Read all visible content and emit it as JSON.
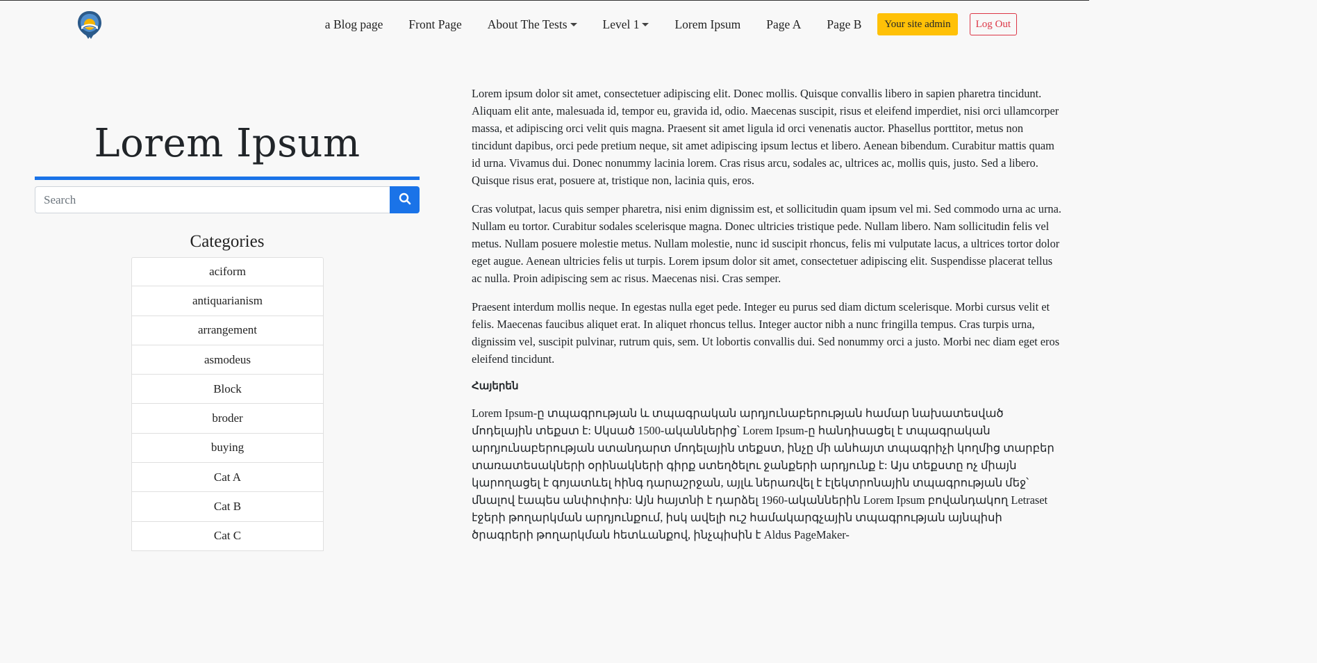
{
  "colors": {
    "accent": "#1a73e8",
    "admin_button": "#ffc107",
    "logout_button": "#dc3545"
  },
  "nav": {
    "logo": "site-logo-icon",
    "items": [
      {
        "label": "a Blog page",
        "dropdown": false
      },
      {
        "label": "Front Page",
        "dropdown": false
      },
      {
        "label": "About The Tests",
        "dropdown": true
      },
      {
        "label": "Level 1",
        "dropdown": true
      },
      {
        "label": "Lorem Ipsum",
        "dropdown": false
      },
      {
        "label": "Page A",
        "dropdown": false
      },
      {
        "label": "Page B",
        "dropdown": false
      }
    ],
    "admin_label": "Your site admin",
    "logout_label": "Log Out"
  },
  "sidebar": {
    "title": "Lorem Ipsum",
    "search": {
      "placeholder": "Search",
      "value": "",
      "icon": "search-icon"
    },
    "categories_title": "Categories",
    "categories": [
      "aciform",
      "antiquarianism",
      "arrangement",
      "asmodeus",
      "Block",
      "broder",
      "buying",
      "Cat A",
      "Cat B",
      "Cat C"
    ]
  },
  "content": {
    "paragraph_1": "Lorem ipsum dolor sit amet, consectetuer adipiscing elit. Donec mollis. Quisque convallis libero in sapien pharetra tincidunt. Aliquam elit ante, malesuada id, tempor eu, gravida id, odio. Maecenas suscipit, risus et eleifend imperdiet, nisi orci ullamcorper massa, et adipiscing orci velit quis magna. Praesent sit amet ligula id orci venenatis auctor. Phasellus porttitor, metus non tincidunt dapibus, orci pede pretium neque, sit amet adipiscing ipsum lectus et libero. Aenean bibendum. Curabitur mattis quam id urna. Vivamus dui. Donec nonummy lacinia lorem. Cras risus arcu, sodales ac, ultrices ac, mollis quis, justo. Sed a libero. Quisque risus erat, posuere at, tristique non, lacinia quis, eros.",
    "paragraph_2": "Cras volutpat, lacus quis semper pharetra, nisi enim dignissim est, et sollicitudin quam ipsum vel mi. Sed commodo urna ac urna. Nullam eu tortor. Curabitur sodales scelerisque magna. Donec ultricies tristique pede. Nullam libero. Nam sollicitudin felis vel metus. Nullam posuere molestie metus. Nullam molestie, nunc id suscipit rhoncus, felis mi vulputate lacus, a ultrices tortor dolor eget augue. Aenean ultricies felis ut turpis. Lorem ipsum dolor sit amet, consectetuer adipiscing elit. Suspendisse placerat tellus ac nulla. Proin adipiscing sem ac risus. Maecenas nisi. Cras semper.",
    "paragraph_3": "Praesent interdum mollis neque. In egestas nulla eget pede. Integer eu purus sed diam dictum scelerisque. Morbi cursus velit et felis. Maecenas faucibus aliquet erat. In aliquet rhoncus tellus. Integer auctor nibh a nunc fringilla tempus. Cras turpis urna, dignissim vel, suscipit pulvinar, rutrum quis, sem. Ut lobortis convallis dui. Sed nonummy orci a justo. Morbi nec diam eget eros eleifend tincidunt.",
    "heading_armenian": "Հայերեն",
    "paragraph_4": "Lorem Ipsum-ը տպագրության և տպագրական արդյունաբերության համար նախատեսված մոդելային տեքստ է: Սկսած 1500-ականներից՝ Lorem Ipsum-ը հանդիսացել է տպագրական արդյունաբերության ստանդարտ մոդելային տեքստ, ինչը մի անհայտ տպագրիչի կողմից տարբեր տառատեսակների օրինակների գիրք ստեղծելու ջանքերի արդյունք է: Այս տեքստը ոչ միայն կարողացել է գոյատևել հինգ դարաշրջան, այլև ներառվել է էլեկտրոնային տպագրության մեջ՝ մնալով էապես անփոփոխ: Այն հայտնի է դարձել 1960-ականներին Lorem Ipsum բովանդակող Letraset էջերի թողարկման արդյունքում, իսկ ավելի ուշ համակարգչային տպագրության այնպիսի ծրագրերի թողարկման հետևանքով, ինչպիսին է Aldus PageMaker-"
  }
}
